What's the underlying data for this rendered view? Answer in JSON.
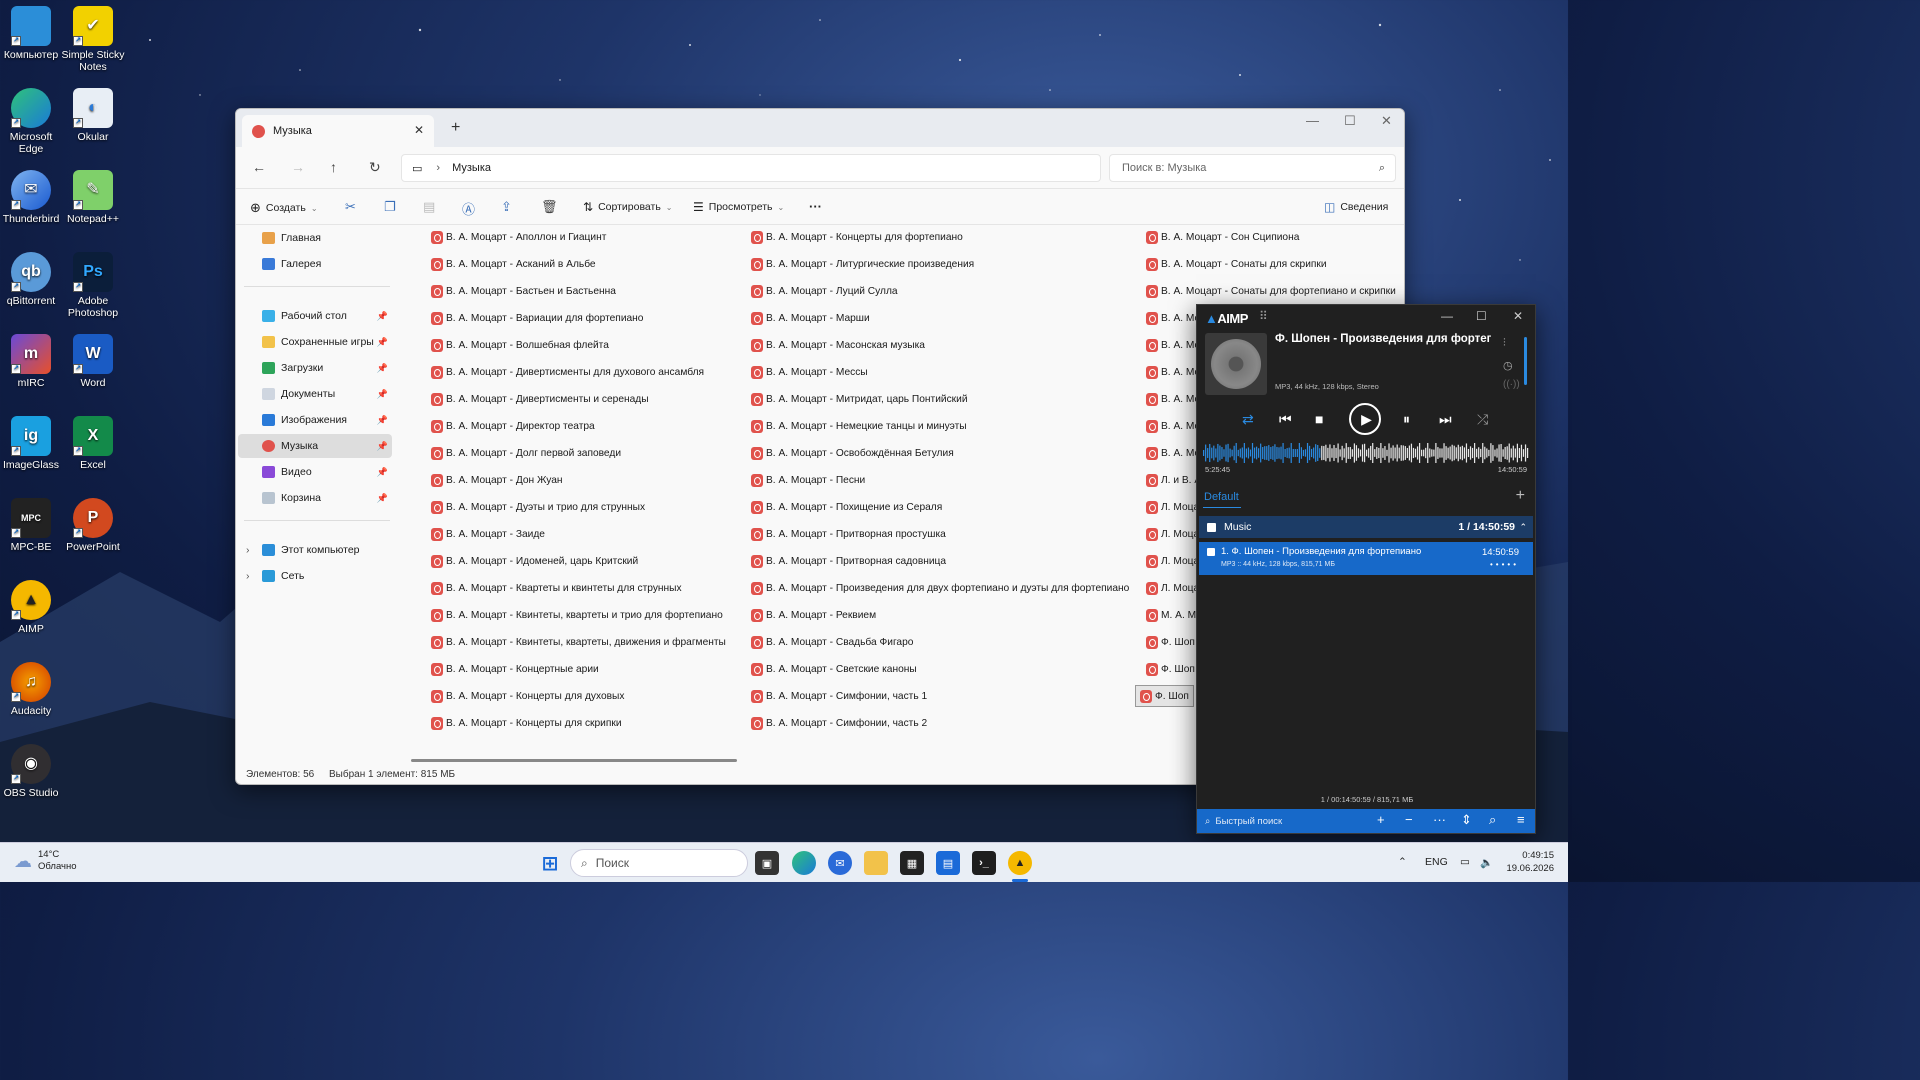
{
  "desktop": {
    "icons": [
      {
        "label": "Компьютер"
      },
      {
        "label": "Simple Sticky Notes"
      },
      {
        "label": "Microsoft Edge"
      },
      {
        "label": "Okular"
      },
      {
        "label": "Thunderbird"
      },
      {
        "label": "Notepad++"
      },
      {
        "label": "qBittorrent"
      },
      {
        "label": "Adobe Photoshop"
      },
      {
        "label": "mIRC"
      },
      {
        "label": "Word"
      },
      {
        "label": "ImageGlass"
      },
      {
        "label": "Excel"
      },
      {
        "label": "MPC-BE"
      },
      {
        "label": "PowerPoint"
      },
      {
        "label": "AIMP"
      },
      {
        "label": "Audacity"
      },
      {
        "label": "OBS Studio"
      }
    ]
  },
  "explorer": {
    "tab_title": "Музыка",
    "breadcrumb": "Музыка",
    "search_placeholder": "Поиск в: Музыка",
    "toolbar": {
      "create": "Создать",
      "sort": "Сортировать",
      "view": "Просмотреть",
      "details": "Сведения"
    },
    "nav": {
      "home": "Главная",
      "gallery": "Галерея",
      "desktop": "Рабочий стол",
      "saved_games": "Сохраненные игры",
      "downloads": "Загрузки",
      "documents": "Документы",
      "images": "Изображения",
      "music": "Музыка",
      "video": "Видео",
      "trash": "Корзина",
      "this_pc": "Этот компьютер",
      "network": "Сеть"
    },
    "columns": [
      [
        "В. А. Моцарт - Аполлон и Гиацинт",
        "В. А. Моцарт - Асканий в Альбе",
        "В. А. Моцарт - Бастьен и Бастьенна",
        "В. А. Моцарт - Вариации для фортепиано",
        "В. А. Моцарт - Волшебная флейта",
        "В. А. Моцарт - Дивертисменты для духового ансамбля",
        "В. А. Моцарт - Дивертисменты и серенады",
        "В. А. Моцарт - Директор театра",
        "В. А. Моцарт - Долг первой заповеди",
        "В. А. Моцарт - Дон Жуан",
        "В. А. Моцарт - Дуэты и трио для струнных",
        "В. А. Моцарт - Заиде",
        "В. А. Моцарт - Идоменей, царь Критский",
        "В. А. Моцарт - Квартеты и квинтеты для струнных",
        "В. А. Моцарт - Квинтеты, квартеты и трио для фортепиано",
        "В. А. Моцарт - Квинтеты, квартеты, движения и фрагменты",
        "В. А. Моцарт - Концертные арии",
        "В. А. Моцарт - Концерты для духовых",
        "В. А. Моцарт - Концерты для скрипки"
      ],
      [
        "В. А. Моцарт - Концерты для фортепиано",
        "В. А. Моцарт - Литургические произведения",
        "В. А. Моцарт - Луций Сулла",
        "В. А. Моцарт - Марши",
        "В. А. Моцарт - Масонская музыка",
        "В. А. Моцарт - Мессы",
        "В. А. Моцарт - Митридат, царь Понтийский",
        "В. А. Моцарт - Немецкие танцы и минуэты",
        "В. А. Моцарт - Освобождённая Бетулия",
        "В. А. Моцарт - Песни",
        "В. А. Моцарт - Похищение из Сераля",
        "В. А. Моцарт - Притворная простушка",
        "В. А. Моцарт - Притворная садовница",
        "В. А. Моцарт - Произведения для двух фортепиано и дуэты для фортепиано",
        "В. А. Моцарт - Реквием",
        "В. А. Моцарт - Свадьба Фигаро",
        "В. А. Моцарт - Светские каноны",
        "В. А. Моцарт - Симфонии, часть 1",
        "В. А. Моцарт - Симфонии, часть 2"
      ],
      [
        "В. А. Моцарт - Сон Сципиона",
        "В. А. Моцарт - Сонаты для скрипки",
        "В. А. Моцарт - Сонаты для фортепиано и скрипки",
        "В. А. Мо",
        "В. А. Мо",
        "В. А. Мо",
        "В. А. Мо",
        "В. А. Мо",
        "В. А. Мо",
        "Л. и В. А",
        "Л. Моца",
        "Л. Моца",
        "Л. Моца",
        "Л. Моца",
        "М. А. М",
        "Ф. Шоп",
        "Ф. Шоп",
        "Ф. Шоп"
      ]
    ],
    "status_count": "Элементов: 56",
    "status_selected": "Выбран 1 элемент: 815 МБ"
  },
  "aimp": {
    "logo": "AIMP",
    "track_title": "Ф. Шопен - Произведения для фортепиано",
    "track_info": "MP3, 44 kHz, 128 kbps, Stereo",
    "time_elapsed": "5:25:45",
    "time_total": "14:50:59",
    "playlist_tab": "Default",
    "group_name": "Music",
    "group_info": "1 / 14:50:59",
    "item_title": "1. Ф. Шопен - Произведения для фортепиано",
    "item_duration": "14:50:59",
    "item_sub": "MP3 :: 44 kHz, 128 kbps, 815,71 МБ",
    "footer_summary": "1 / 00:14:50:59 / 815,71 МБ",
    "quick_search": "Быстрый поиск",
    "progress_fraction": 0.365
  },
  "taskbar": {
    "temperature": "14°C",
    "weather": "Облачно",
    "search": "Поиск",
    "lang": "ENG",
    "time": "0:49:15",
    "date": "19.06.2026"
  }
}
